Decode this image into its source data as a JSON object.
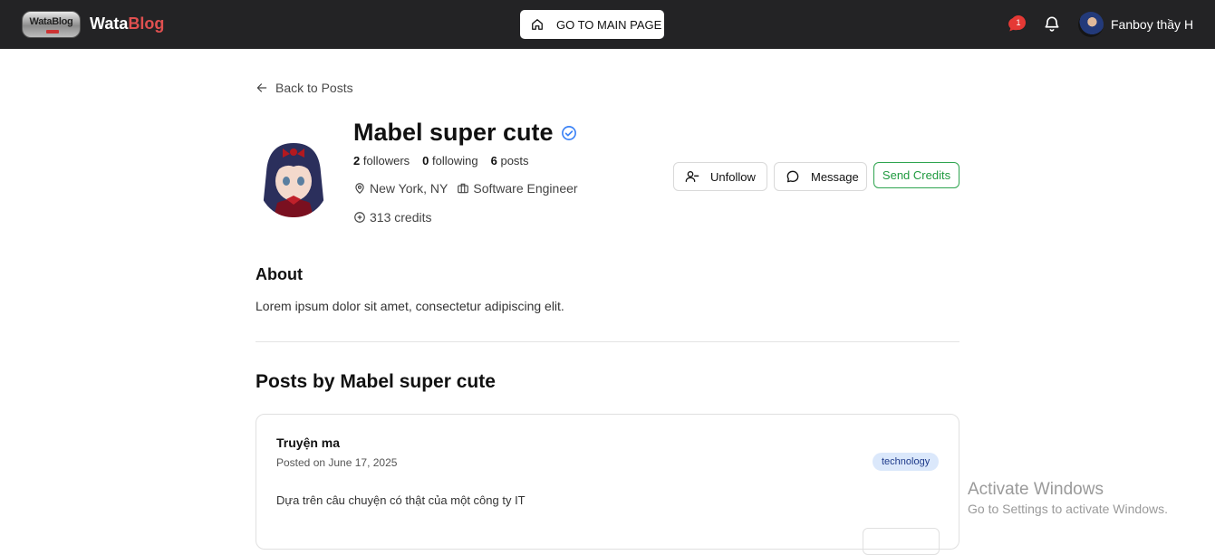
{
  "header": {
    "logo_text": "WataBlog",
    "brand_part1": "Wata",
    "brand_part2": "Blog",
    "main_page_label": "GO TO MAIN PAGE",
    "message_badge_count": "1",
    "username": "Fanboy thầy H"
  },
  "nav": {
    "back_label": "Back to Posts"
  },
  "profile": {
    "name": "Mabel super cute",
    "followers_count": "2",
    "followers_label": "followers",
    "following_count": "0",
    "following_label": "following",
    "posts_count": "6",
    "posts_label": "posts",
    "location": "New York, NY",
    "occupation": "Software Engineer",
    "credits": "313 credits"
  },
  "actions": {
    "unfollow_label": "Unfollow",
    "message_label": "Message",
    "send_credits_label": "Send Credits"
  },
  "about": {
    "heading": "About",
    "text": "Lorem ipsum dolor sit amet, consectetur adipiscing elit."
  },
  "posts": {
    "heading": "Posts by Mabel super cute",
    "items": [
      {
        "title": "Truyện ma",
        "date": "Posted on June 17, 2025",
        "tag": "technology",
        "excerpt": "Dựa trên câu chuyện có thật của một công ty IT"
      }
    ]
  },
  "watermark": {
    "line1": "Activate Windows",
    "line2": "Go to Settings to activate Windows."
  },
  "colors": {
    "topbar": "#232325",
    "brand_accent": "#e05050",
    "send_credits": "#1f9a3f",
    "verified": "#3b82f6",
    "badge": "#e53935"
  }
}
